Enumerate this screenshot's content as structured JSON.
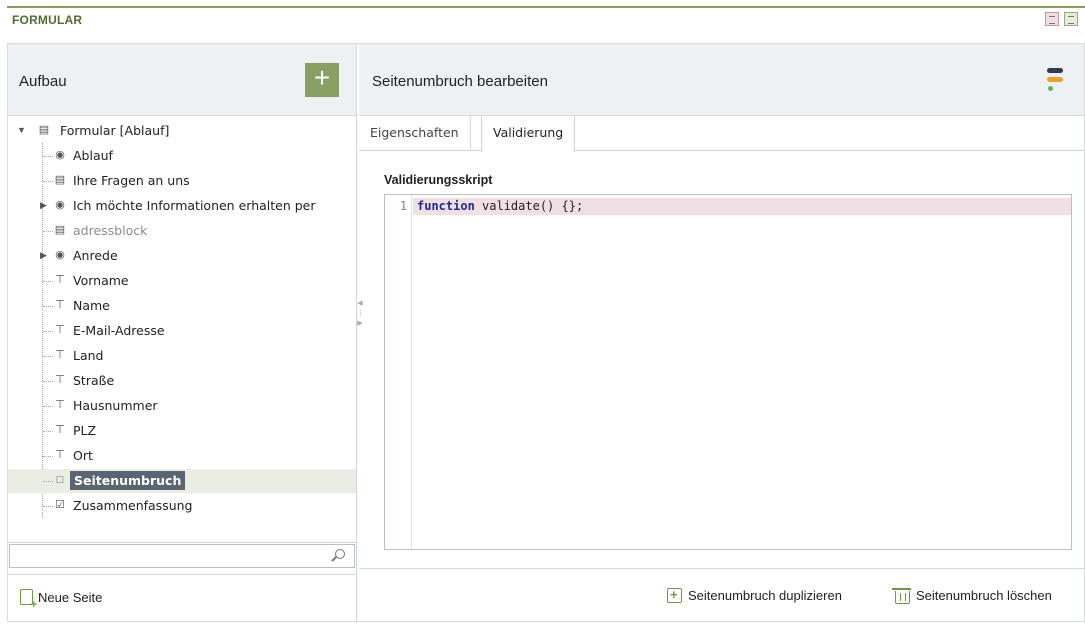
{
  "app": {
    "title": "FORMULAR"
  },
  "left": {
    "title": "Aufbau",
    "add_button": "+",
    "tree": [
      {
        "label": "Formular [Ablauf]",
        "icon": "form-icon",
        "arrow": "▼"
      },
      {
        "label": "Ablauf",
        "icon": "flow-icon"
      },
      {
        "label": "Ihre Fragen an uns",
        "icon": "textarea-icon"
      },
      {
        "label": "Ich möchte Informationen erhalten per",
        "icon": "radio-icon",
        "arrow": "▶"
      },
      {
        "label": "adressblock",
        "icon": "block-icon",
        "disabled": true
      },
      {
        "label": "Anrede",
        "icon": "radio-icon",
        "arrow": "▶"
      },
      {
        "label": "Vorname",
        "icon": "textfield-icon"
      },
      {
        "label": "Name",
        "icon": "textfield-icon"
      },
      {
        "label": "E-Mail-Adresse",
        "icon": "textfield-icon"
      },
      {
        "label": "Land",
        "icon": "textfield-icon"
      },
      {
        "label": "Straße",
        "icon": "textfield-icon"
      },
      {
        "label": "Hausnummer",
        "icon": "textfield-icon"
      },
      {
        "label": "PLZ",
        "icon": "textfield-icon"
      },
      {
        "label": "Ort",
        "icon": "textfield-icon"
      },
      {
        "label": "Seitenumbruch",
        "icon": "pagebreak-icon",
        "selected": true
      },
      {
        "label": "Zusammenfassung",
        "icon": "summary-icon"
      }
    ],
    "search_value": "",
    "new_page_label": "Neue Seite"
  },
  "right": {
    "title": "Seitenumbruch bearbeiten",
    "tabs": [
      {
        "label": "Eigenschaften",
        "active": false
      },
      {
        "label": "Validierung",
        "active": true
      }
    ],
    "section_label": "Validierungsskript",
    "code": {
      "line_number": "1",
      "keyword": "function",
      "rest": " validate() {};"
    },
    "duplicate_label": "Seitenumbruch duplizieren",
    "delete_label": "Seitenumbruch löschen"
  },
  "colors": {
    "accent": "#8aa063",
    "selected_bg": "#5b6471",
    "code_highlight": "#f1dfe3",
    "keyword": "#1b2b9c"
  }
}
